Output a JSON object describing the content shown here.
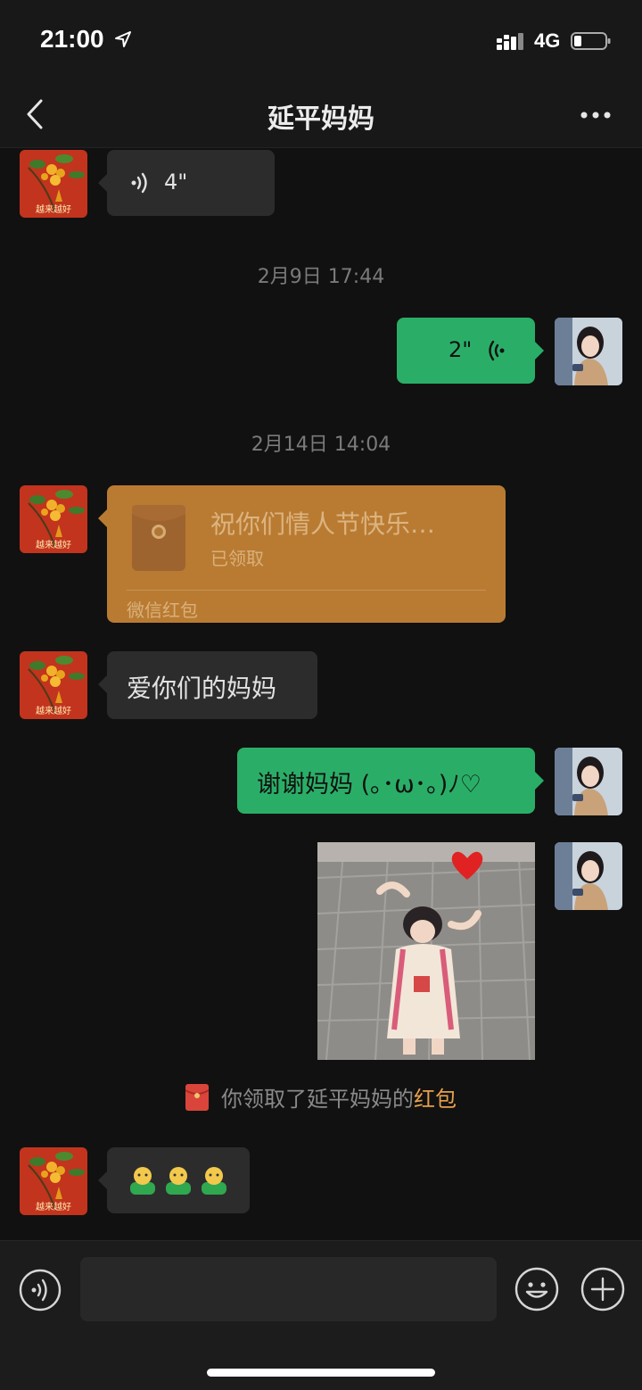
{
  "status_bar": {
    "time": "21:00",
    "network": "4G"
  },
  "header": {
    "title": "延平妈妈"
  },
  "avatars": {
    "contact_text": "越来越好"
  },
  "messages": {
    "m1_voice_duration": "4\"",
    "ts1": "2月9日 17:44",
    "m2_voice_duration": "2\"",
    "ts2": "2月14日 14:04",
    "hongbao": {
      "title": "祝你们情人节快乐…",
      "status": "已领取",
      "footer": "微信红包"
    },
    "m4_text": "爱你们的妈妈",
    "m5_text": "谢谢妈妈 (｡･ω･｡)ﾉ♡",
    "system_note": {
      "prefix": "你领取了延平妈妈的",
      "link": "红包"
    },
    "m7_emoji": [
      "🧍",
      "🧍",
      "🧍"
    ]
  },
  "colors": {
    "bg": "#111111",
    "bubble_dark": "#2c2c2c",
    "bubble_green": "#2aae67",
    "hongbao": "#b97b32",
    "link": "#e7a04c"
  },
  "icons": [
    "location-arrow-icon",
    "signal-icon",
    "battery-icon",
    "back-chevron-icon",
    "more-dots-icon",
    "voice-wave-icon",
    "red-envelope-icon",
    "voice-mode-icon",
    "emoji-icon",
    "plus-icon"
  ]
}
